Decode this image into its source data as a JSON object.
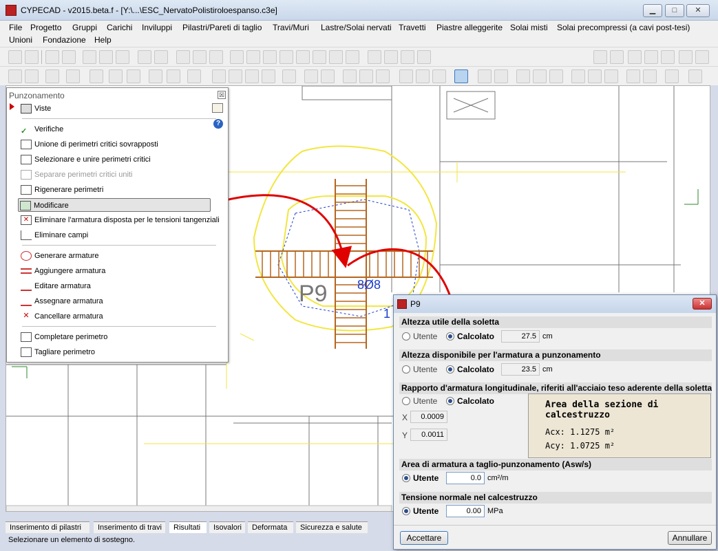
{
  "window": {
    "title": "CYPECAD - v2015.beta.f - [Y:\\...\\ESC_NervatoPolistiroloespanso.c3e]",
    "min": "▁",
    "max": "□",
    "close": "✕"
  },
  "menu": [
    "File",
    "Progetto",
    "Gruppi",
    "Carichi",
    "Inviluppi",
    "Pilastri/Pareti di taglio",
    "Travi/Muri",
    "Lastre/Solai nervati",
    "Travetti",
    "Piastre alleggerite",
    "Solai misti",
    "Solai precompressi (a cavi post-tesi)",
    "Unioni",
    "Fondazione",
    "Help"
  ],
  "panel": {
    "title": "Punzonamento",
    "close": "☒",
    "items": [
      {
        "label": "Viste",
        "icon": "views-icon"
      },
      {
        "label": "Verifiche",
        "icon": "check-icon"
      },
      {
        "label": "Unione di perimetri critici sovrapposti",
        "icon": "union-perimeter-icon"
      },
      {
        "label": "Selezionare e unire perimetri critici",
        "icon": "select-perimeter-icon"
      },
      {
        "label": "Separare perimetri critici uniti",
        "icon": "separate-perimeter-icon"
      },
      {
        "label": "Rigenerare perimetri",
        "icon": "regenerate-icon"
      },
      {
        "label": "Modificare",
        "icon": "modify-icon"
      },
      {
        "label": "Eliminare l'armatura disposta per le tensioni tangenziali",
        "icon": "delete-rebar-icon"
      },
      {
        "label": "Eliminare campi",
        "icon": "delete-fields-icon"
      },
      {
        "label": "Generare armature",
        "icon": "generate-rebar-icon"
      },
      {
        "label": "Aggiungere armatura",
        "icon": "add-rebar-icon"
      },
      {
        "label": "Editare armatura",
        "icon": "edit-rebar-icon"
      },
      {
        "label": "Assegnare armatura",
        "icon": "assign-rebar-icon"
      },
      {
        "label": "Cancellare armatura",
        "icon": "erase-rebar-icon"
      },
      {
        "label": "Completare perimetro",
        "icon": "complete-perimeter-icon"
      },
      {
        "label": "Tagliare perimetro",
        "icon": "cut-perimeter-icon"
      }
    ]
  },
  "drawing": {
    "column_label": "P9",
    "rebar_label": "8Ø8",
    "partial_label": "1"
  },
  "tabs": [
    "Inserimento di pilastri",
    "Inserimento di travi",
    "Risultati",
    "Isovalori",
    "Deformata",
    "Sicurezza e salute"
  ],
  "status": "Selezionare un elemento di sostegno.",
  "dialog": {
    "title": "P9",
    "close": "✕",
    "sec1": {
      "title": "Altezza utile della soletta",
      "opt_user": "Utente",
      "opt_calc": "Calcolato",
      "value": "27.5",
      "unit": "cm"
    },
    "sec2": {
      "title": "Altezza disponibile per l'armatura a punzonamento",
      "opt_user": "Utente",
      "opt_calc": "Calcolato",
      "value": "23.5",
      "unit": "cm"
    },
    "sec3": {
      "title": "Rapporto d'armatura longitudinale, riferiti all'acciaio teso aderente della soletta",
      "opt_user": "Utente",
      "opt_calc": "Calcolato",
      "x_label": "X",
      "x_value": "0.0009",
      "y_label": "Y",
      "y_value": "0.0011"
    },
    "info": {
      "title": "Area della sezione di calcestruzzo",
      "acx": "Acx: 1.1275 m²",
      "acy": "Acy: 1.0725 m²"
    },
    "sec4": {
      "title": "Area di armatura a taglio-punzonamento (Asw/s)",
      "opt_user": "Utente",
      "value": "0.0",
      "unit": "cm²/m"
    },
    "sec5": {
      "title": "Tensione normale nel calcestruzzo",
      "opt_user": "Utente",
      "value": "0.00",
      "unit": "MPa"
    },
    "ok": "Accettare",
    "cancel": "Annullare"
  },
  "colors": {
    "rebar": "#b5651d",
    "perimeter": "#f2e640",
    "arrow": "#e00000",
    "label_blue": "#1a3ccc"
  }
}
